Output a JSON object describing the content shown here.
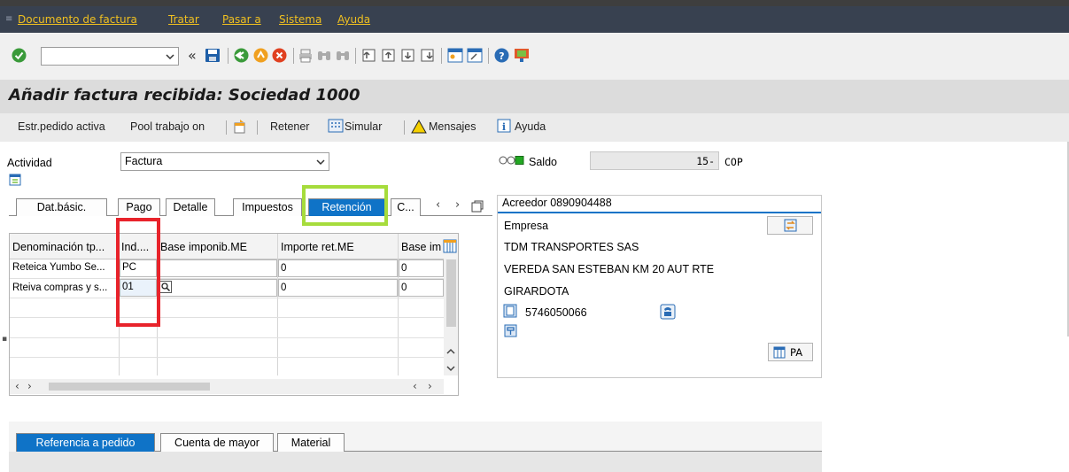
{
  "menu": {
    "items": [
      "Documento de factura",
      "Tratar",
      "Pasar a",
      "Sistema",
      "Ayuda"
    ]
  },
  "toolbar": {
    "command_field_value": "",
    "icons": [
      "check-icon",
      "back-icon",
      "save-icon",
      "exit-icon",
      "cancel-icon",
      "print-icon",
      "find-icon",
      "find-next-icon",
      "first-page-icon",
      "prev-page-icon",
      "next-page-icon",
      "last-page-icon",
      "new-session-icon",
      "shortcut-icon",
      "help-icon",
      "customize-layout-icon"
    ]
  },
  "title": "Añadir factura recibida: Sociedad 1000",
  "app_toolbar": {
    "estr_pedido": "Estr.pedido activa",
    "pool_trabajo": "Pool trabajo on",
    "retener": "Retener",
    "simular": "Simular",
    "mensajes": "Mensajes",
    "ayuda": "Ayuda"
  },
  "actividad": {
    "label": "Actividad",
    "value": "Factura"
  },
  "saldo": {
    "label": "Saldo",
    "value": "15-",
    "currency": "COP",
    "status_color": "#23a823"
  },
  "tabs": [
    {
      "label": "Dat.básic.",
      "active": false
    },
    {
      "label": "Pago",
      "active": false
    },
    {
      "label": "Detalle",
      "active": false
    },
    {
      "label": "Impuestos",
      "active": false
    },
    {
      "label": "Retención",
      "active": true
    },
    {
      "label": "C...",
      "active": false
    }
  ],
  "withholding_table": {
    "columns": [
      "Denominación tp...",
      "Ind....",
      "Base imponib.ME",
      "Importe ret.ME",
      "Base im"
    ],
    "rows": [
      {
        "denominacion": "Reteica Yumbo Se...",
        "indicador": "PC",
        "base": "",
        "importe": "0",
        "base_im": "0"
      },
      {
        "denominacion": "Rteiva compras y s...",
        "indicador": "01",
        "base": "",
        "importe": "0",
        "base_im": "0"
      }
    ]
  },
  "vendor": {
    "acreedor": "Acreedor 0890904488",
    "empresa": "Empresa",
    "name": "TDM TRANSPORTES SAS",
    "address": "VEREDA SAN ESTEBAN KM 20 AUT RTE",
    "city": "GIRARDOTA",
    "phone": "5746050066",
    "pa_button": "PA"
  },
  "bottom_tabs": [
    {
      "label": "Referencia a pedido",
      "active": true
    },
    {
      "label": "Cuenta de mayor",
      "active": false
    },
    {
      "label": "Material",
      "active": false
    }
  ],
  "highlight_colors": {
    "red_box": "#e8232b",
    "green_box": "#a6dc3c"
  }
}
